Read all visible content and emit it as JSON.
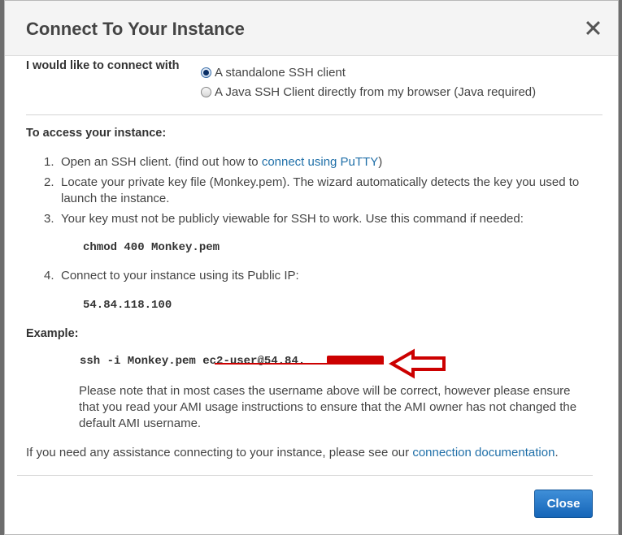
{
  "dialog": {
    "title": "Connect To Your Instance"
  },
  "connect": {
    "label": "I would like to connect with",
    "options": [
      {
        "label": "A standalone SSH client",
        "selected": true
      },
      {
        "label": "A Java SSH Client directly from my browser (Java required)",
        "selected": false
      }
    ]
  },
  "access": {
    "heading": "To access your instance:",
    "steps": [
      {
        "num": "1.",
        "text": "Open an SSH client. (find out how to",
        "link": "connect using PuTTY",
        "after": ")"
      },
      {
        "num": "2.",
        "line1": "Locate your private key file (Monkey.pem). The wizard automatically detects the key you used to",
        "line2": "launch the instance."
      },
      {
        "num": "3.",
        "text": "Your key must not be publicly viewable for SSH to work. Use this command if needed:",
        "code": "chmod 400 Monkey.pem"
      },
      {
        "num": "4.",
        "text": "Connect to your instance using its Public IP:",
        "code": "54.84.118.100"
      }
    ]
  },
  "example": {
    "heading": "Example:",
    "cmd_prefix": "ssh -i Monkey.pem ",
    "cmd_user": "ec2-user@54.84.",
    "note_line1": "Please note that in most cases the username above will be correct, however please ensure",
    "note_line2": "that you read your AMI usage instructions to ensure that the AMI owner has not changed the",
    "note_line3": "default AMI username."
  },
  "help": {
    "text": "If you need any assistance connecting to your instance, please see our",
    "link": "connection documentation",
    "after": "."
  },
  "footer": {
    "close_label": "Close"
  },
  "colors": {
    "link": "#1f6fa8",
    "button": "#1565b8",
    "annotation": "#cc0000"
  }
}
